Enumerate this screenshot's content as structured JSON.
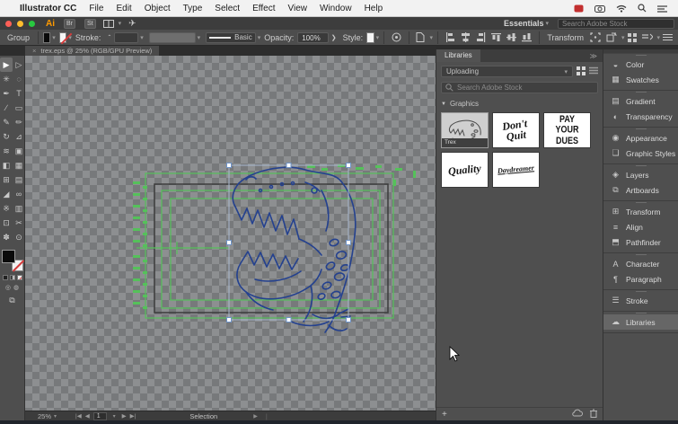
{
  "menu_bar": {
    "apple": "",
    "app_name": "Illustrator CC",
    "items": [
      "File",
      "Edit",
      "Object",
      "Type",
      "Select",
      "Effect",
      "View",
      "Window",
      "Help"
    ]
  },
  "title_bar": {
    "logo": "Ai",
    "bridge": "Br",
    "stock_icon": "St",
    "workspace": "Essentials",
    "search_placeholder": "Search Adobe Stock"
  },
  "control_bar": {
    "group_label": "Group",
    "stroke_label": "Stroke:",
    "line_style": "Basic",
    "opacity_label": "Opacity:",
    "opacity_value": "100%",
    "style_label": "Style:",
    "transform_label": "Transform"
  },
  "document_tab": {
    "close": "×",
    "title": "trex.eps @ 25% (RGB/GPU Preview)"
  },
  "toolbar": {
    "tools": [
      {
        "name": "selection-tool",
        "glyph": "▶"
      },
      {
        "name": "direct-selection-tool",
        "glyph": "▷"
      },
      {
        "name": "magic-wand-tool",
        "glyph": "✳"
      },
      {
        "name": "lasso-tool",
        "glyph": "◌"
      },
      {
        "name": "pen-tool",
        "glyph": "✒"
      },
      {
        "name": "type-tool",
        "glyph": "T"
      },
      {
        "name": "line-tool",
        "glyph": "∕"
      },
      {
        "name": "rectangle-tool",
        "glyph": "▭"
      },
      {
        "name": "paintbrush-tool",
        "glyph": "✎"
      },
      {
        "name": "pencil-tool",
        "glyph": "✏"
      },
      {
        "name": "rotate-tool",
        "glyph": "↻"
      },
      {
        "name": "scale-tool",
        "glyph": "⊿"
      },
      {
        "name": "width-tool",
        "glyph": "≋"
      },
      {
        "name": "free-transform-tool",
        "glyph": "▣"
      },
      {
        "name": "shape-builder-tool",
        "glyph": "◧"
      },
      {
        "name": "perspective-grid-tool",
        "glyph": "▦"
      },
      {
        "name": "mesh-tool",
        "glyph": "⊞"
      },
      {
        "name": "gradient-tool",
        "glyph": "▤"
      },
      {
        "name": "eyedropper-tool",
        "glyph": "◢"
      },
      {
        "name": "blend-tool",
        "glyph": "∞"
      },
      {
        "name": "symbol-sprayer-tool",
        "glyph": "※"
      },
      {
        "name": "graph-tool",
        "glyph": "▥"
      },
      {
        "name": "artboard-tool",
        "glyph": "⊡"
      },
      {
        "name": "slice-tool",
        "glyph": "✂"
      },
      {
        "name": "hand-tool",
        "glyph": "✽"
      },
      {
        "name": "zoom-tool",
        "glyph": "⊙"
      }
    ]
  },
  "libraries": {
    "tab": "Libraries",
    "collapse": "≫",
    "folder_value": "Uploading",
    "search_placeholder": "Search Adobe Stock",
    "section": "Graphics",
    "items": [
      {
        "label": "Trex"
      },
      {
        "lines": [
          "Don't",
          "Quit"
        ]
      },
      {
        "lines": [
          "PAY",
          "YOUR",
          "DUES"
        ]
      },
      {
        "lines": [
          "Quality"
        ]
      },
      {
        "lines": [
          "Daydreamer"
        ]
      }
    ]
  },
  "dock": {
    "items": [
      {
        "label": "Color",
        "glyph": "◒"
      },
      {
        "label": "Swatches",
        "glyph": "▦"
      },
      {
        "label": "Gradient",
        "glyph": "▤"
      },
      {
        "label": "Transparency",
        "glyph": "◐"
      },
      {
        "label": "Appearance",
        "glyph": "◉"
      },
      {
        "label": "Graphic Styles",
        "glyph": "❏"
      },
      {
        "label": "Layers",
        "glyph": "◈"
      },
      {
        "label": "Artboards",
        "glyph": "⧉"
      },
      {
        "label": "Transform",
        "glyph": "⊞"
      },
      {
        "label": "Align",
        "glyph": "≡"
      },
      {
        "label": "Pathfinder",
        "glyph": "⬒"
      },
      {
        "label": "Character",
        "glyph": "A"
      },
      {
        "label": "Paragraph",
        "glyph": "¶"
      },
      {
        "label": "Stroke",
        "glyph": "☰"
      },
      {
        "label": "Libraries",
        "glyph": "☁"
      }
    ]
  },
  "status_bar": {
    "zoom": "25%",
    "artboard": "1",
    "status": "Selection"
  },
  "colors": {
    "selection_green": "#55c15a",
    "artwork_blue": "#24418f",
    "panel_bg": "#4f4f4f",
    "accent_orange": "#ff9a00"
  }
}
